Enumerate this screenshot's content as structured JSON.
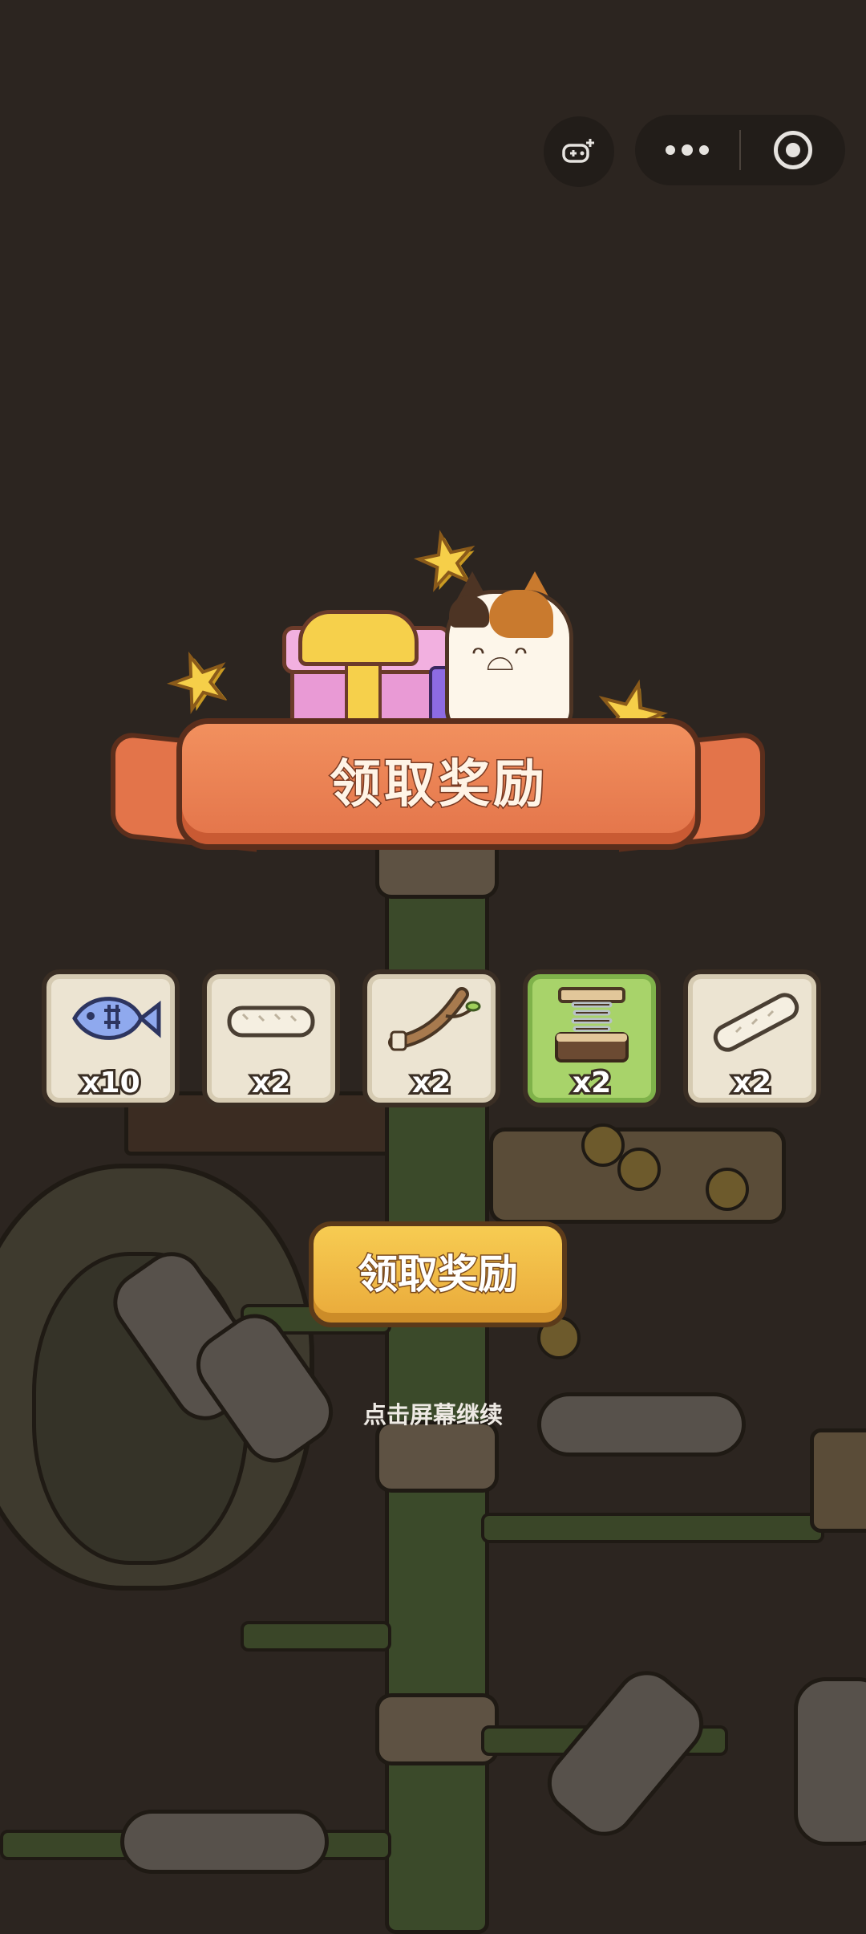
{
  "header": {
    "banner_title": "领取奖励"
  },
  "rewards": [
    {
      "icon": "fish-icon",
      "count": "x10"
    },
    {
      "icon": "sisal-log-icon",
      "count": "x2"
    },
    {
      "icon": "branch-icon",
      "count": "x2"
    },
    {
      "icon": "spring-platform-icon",
      "count": "x2",
      "highlight": "#a8d36a"
    },
    {
      "icon": "sisal-stick-icon",
      "count": "x2"
    }
  ],
  "claim_button": {
    "label": "领取奖励"
  },
  "continue_hint": "点击屏幕继续",
  "colors": {
    "banner": "#e3744a",
    "button": "#f7cc52",
    "background_dim": "#2c2520"
  }
}
